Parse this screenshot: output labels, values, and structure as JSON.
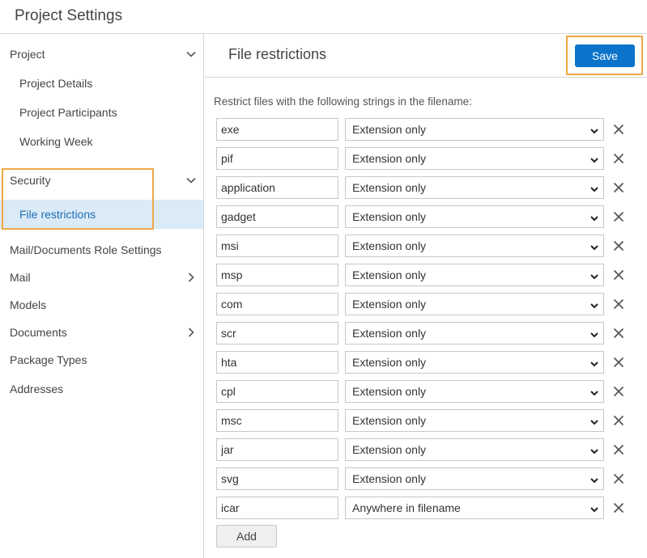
{
  "header": {
    "title": "Project Settings"
  },
  "sidebar": {
    "items": [
      {
        "label": "Project",
        "level": "top",
        "chevron": "down"
      },
      {
        "label": "Project Details",
        "level": "sub",
        "chevron": ""
      },
      {
        "label": "Project Participants",
        "level": "sub",
        "chevron": ""
      },
      {
        "label": "Working Week",
        "level": "sub",
        "chevron": ""
      },
      {
        "label": "Security",
        "level": "top",
        "chevron": "down"
      },
      {
        "label": "File restrictions",
        "level": "sub",
        "chevron": "",
        "active": true
      },
      {
        "label": "Mail/Documents Role Settings",
        "level": "top",
        "chevron": ""
      },
      {
        "label": "Mail",
        "level": "top",
        "chevron": "right"
      },
      {
        "label": "Models",
        "level": "top",
        "chevron": ""
      },
      {
        "label": "Documents",
        "level": "top",
        "chevron": "right"
      },
      {
        "label": "Package Types",
        "level": "top",
        "chevron": ""
      },
      {
        "label": "Addresses",
        "level": "top",
        "chevron": ""
      }
    ]
  },
  "main": {
    "title": "File restrictions",
    "save_label": "Save",
    "description": "Restrict files with the following strings in the filename:",
    "add_label": "Add",
    "restrictions": [
      {
        "name": "exe",
        "mode": "Extension only"
      },
      {
        "name": "pif",
        "mode": "Extension only"
      },
      {
        "name": "application",
        "mode": "Extension only"
      },
      {
        "name": "gadget",
        "mode": "Extension only"
      },
      {
        "name": "msi",
        "mode": "Extension only"
      },
      {
        "name": "msp",
        "mode": "Extension only"
      },
      {
        "name": "com",
        "mode": "Extension only"
      },
      {
        "name": "scr",
        "mode": "Extension only"
      },
      {
        "name": "hta",
        "mode": "Extension only"
      },
      {
        "name": "cpl",
        "mode": "Extension only"
      },
      {
        "name": "msc",
        "mode": "Extension only"
      },
      {
        "name": "jar",
        "mode": "Extension only"
      },
      {
        "name": "svg",
        "mode": "Extension only"
      },
      {
        "name": "icar",
        "mode": "Anywhere in filename"
      }
    ]
  },
  "colors": {
    "accent": "#0b73c9",
    "active_bg": "#dbeaf7",
    "active_text": "#1d6fb5",
    "highlight": "#f0a846"
  },
  "icons": {
    "chevron_down": "chevron-down-icon",
    "chevron_right": "chevron-right-icon",
    "caret": "caret-down-icon",
    "remove": "close-icon"
  }
}
